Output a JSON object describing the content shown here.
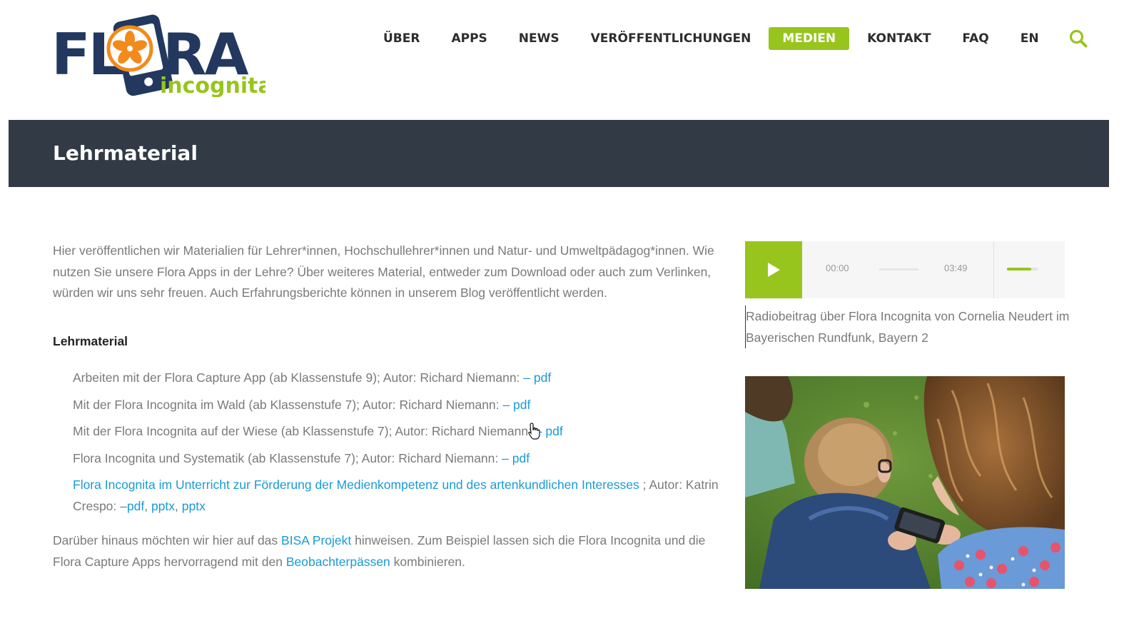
{
  "logo": {
    "word": "FLORA",
    "sub": "incognita",
    "colors": {
      "navy": "#22385e",
      "green": "#97c51d",
      "orange": "#f28a1c"
    }
  },
  "nav": {
    "items": [
      "ÜBER",
      "APPS",
      "NEWS",
      "VERÖFFENTLICHUNGEN",
      "MEDIEN",
      "KONTAKT",
      "FAQ",
      "EN"
    ],
    "active": "MEDIEN",
    "search_icon": "search-icon"
  },
  "page": {
    "title": "Lehrmaterial"
  },
  "content": {
    "intro": "Hier veröffentlichen wir Materialien für Lehrer*innen, Hochschullehrer*innen und Natur- und Umweltpädagog*innen.  Wie nutzen Sie unsere Flora Apps in der Lehre? Über weiteres Material, entweder zum Download oder auch zum Verlinken, würden wir uns sehr freuen.  Auch Erfahrungsberichte können in unserem Blog veröffentlicht werden.",
    "section_heading": "Lehrmaterial",
    "materials": [
      {
        "text": "Arbeiten mit der Flora Capture App (ab Klassenstufe 9);  Autor: Richard Niemann: ",
        "link": "– pdf"
      },
      {
        "text": "Mit der Flora Incognita im Wald (ab Klassenstufe 7); Autor: Richard Niemann:  ",
        "link": "– pdf"
      },
      {
        "text": "Mit der Flora Incognita auf der Wiese (ab Klassenstufe 7); Autor: Richard Niemann: ",
        "link": "– pdf"
      },
      {
        "text": "Flora Incognita und Systematik (ab Klassenstufe 7); Autor: Richard Niemann: ",
        "link": "– pdf"
      }
    ],
    "special": {
      "link_title": "Flora Incognita im Unterricht zur Förderung der Medienkompetenz und des artenkundlichen Interesses",
      "author_text": " ; Autor: Katrin Crespo: –",
      "pdf": "pdf",
      "pptx1": "pptx",
      "pptx2": "pptx",
      "sep": ", "
    },
    "outro": {
      "part1": "Darüber hinaus möchten wir hier auf das ",
      "link1": "BISA Projekt",
      "part2": " hinweisen. Zum Beispiel lassen sich die Flora Incognita und die Flora Capture Apps hervorragend mit den ",
      "link2": "Beobachterpässen",
      "part3": " kombinieren."
    }
  },
  "sidebar": {
    "player": {
      "current_time": "00:00",
      "duration": "03:49",
      "progress": 0,
      "volume": 0.8
    },
    "caption": "Radiobeitrag über Flora Incognita von Cornelia Neudert im Bayerischen Rundfunk, Bayern 2"
  },
  "colors": {
    "accent": "#97c51d",
    "band": "#323a45",
    "link": "#1a9ad6",
    "text": "#7a7a7a"
  }
}
